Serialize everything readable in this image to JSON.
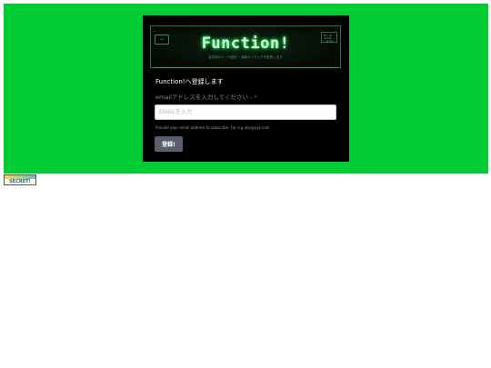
{
  "banner": {
    "title": "Function!",
    "subtitle": "会員制のメール配信 ─ 最新のトピックを配信します",
    "left_badge": "▸▸",
    "right_badge": "Mon 20 · 00:00 · 12:44"
  },
  "form": {
    "heading": "Function!へ登録します",
    "email_label": "emailアドレスを入力してください - ",
    "required_mark": "*",
    "email_placeholder": "EMAILを入力",
    "email_value": "",
    "helper_text": "Provide your email address to subscribe. For e.g abc@xyz.com",
    "submit_label": "登録!"
  },
  "footer_badge": {
    "text": "SECRET!"
  },
  "colors": {
    "page_background": "#00cc33",
    "card_background": "#000000",
    "button_background": "#5a5f6e",
    "required": "#e23b3b"
  }
}
